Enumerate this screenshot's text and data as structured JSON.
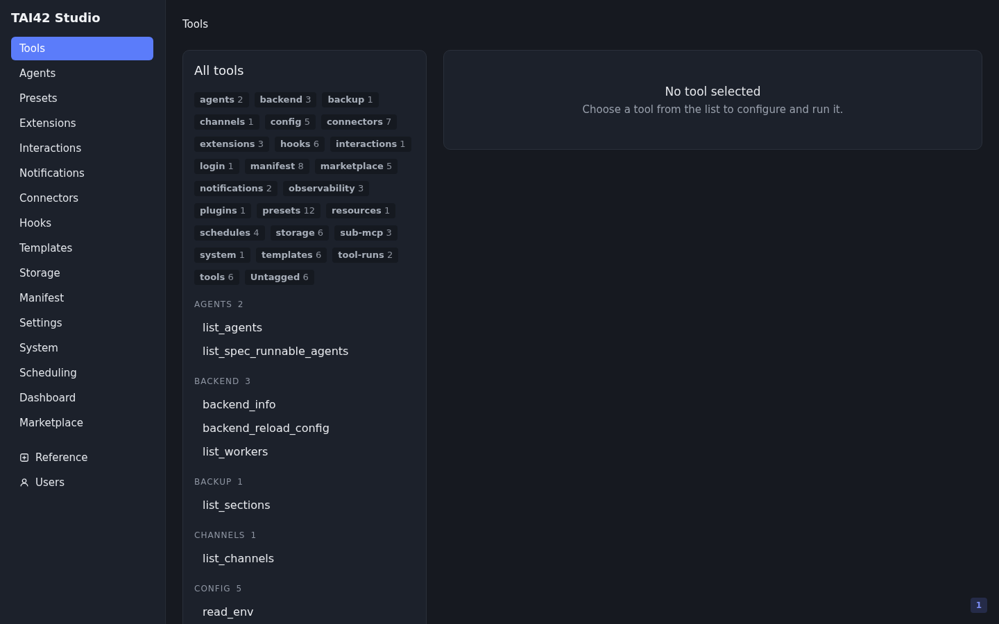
{
  "sidebar": {
    "title": "TAI42 Studio",
    "items": [
      {
        "label": "Tools",
        "selected": true
      },
      {
        "label": "Agents",
        "selected": false
      },
      {
        "label": "Presets",
        "selected": false
      },
      {
        "label": "Extensions",
        "selected": false
      },
      {
        "label": "Interactions",
        "selected": false
      },
      {
        "label": "Notifications",
        "selected": false
      },
      {
        "label": "Connectors",
        "selected": false
      },
      {
        "label": "Hooks",
        "selected": false
      },
      {
        "label": "Templates",
        "selected": false
      },
      {
        "label": "Storage",
        "selected": false
      },
      {
        "label": "Manifest",
        "selected": false
      },
      {
        "label": "Settings",
        "selected": false
      },
      {
        "label": "System",
        "selected": false
      },
      {
        "label": "Scheduling",
        "selected": false
      },
      {
        "label": "Dashboard",
        "selected": false
      },
      {
        "label": "Marketplace",
        "selected": false
      }
    ],
    "footer_items": [
      {
        "label": "Reference"
      },
      {
        "label": "Users"
      }
    ]
  },
  "page_title": "Tools",
  "tools_panel": {
    "title": "All tools",
    "tags": [
      {
        "name": "agents",
        "count": "2"
      },
      {
        "name": "backend",
        "count": "3"
      },
      {
        "name": "backup",
        "count": "1"
      },
      {
        "name": "channels",
        "count": "1"
      },
      {
        "name": "config",
        "count": "5"
      },
      {
        "name": "connectors",
        "count": "7"
      },
      {
        "name": "extensions",
        "count": "3"
      },
      {
        "name": "hooks",
        "count": "6"
      },
      {
        "name": "interactions",
        "count": "1"
      },
      {
        "name": "login",
        "count": "1"
      },
      {
        "name": "manifest",
        "count": "8"
      },
      {
        "name": "marketplace",
        "count": "5"
      },
      {
        "name": "notifications",
        "count": "2"
      },
      {
        "name": "observability",
        "count": "3"
      },
      {
        "name": "plugins",
        "count": "1"
      },
      {
        "name": "presets",
        "count": "12"
      },
      {
        "name": "resources",
        "count": "1"
      },
      {
        "name": "schedules",
        "count": "4"
      },
      {
        "name": "storage",
        "count": "6"
      },
      {
        "name": "sub-mcp",
        "count": "3"
      },
      {
        "name": "system",
        "count": "1"
      },
      {
        "name": "templates",
        "count": "6"
      },
      {
        "name": "tool-runs",
        "count": "2"
      },
      {
        "name": "tools",
        "count": "6"
      },
      {
        "name": "Untagged",
        "count": "6"
      }
    ],
    "sections": [
      {
        "name": "AGENTS",
        "count": "2",
        "tools": [
          "list_agents",
          "list_spec_runnable_agents"
        ]
      },
      {
        "name": "BACKEND",
        "count": "3",
        "tools": [
          "backend_info",
          "backend_reload_config",
          "list_workers"
        ]
      },
      {
        "name": "BACKUP",
        "count": "1",
        "tools": [
          "list_sections"
        ]
      },
      {
        "name": "CHANNELS",
        "count": "1",
        "tools": [
          "list_channels"
        ]
      },
      {
        "name": "CONFIG",
        "count": "5",
        "tools": [
          "read_env"
        ]
      }
    ]
  },
  "detail_panel": {
    "title": "No tool selected",
    "message": "Choose a tool from the list to configure and run it."
  },
  "corner_badge": "1"
}
